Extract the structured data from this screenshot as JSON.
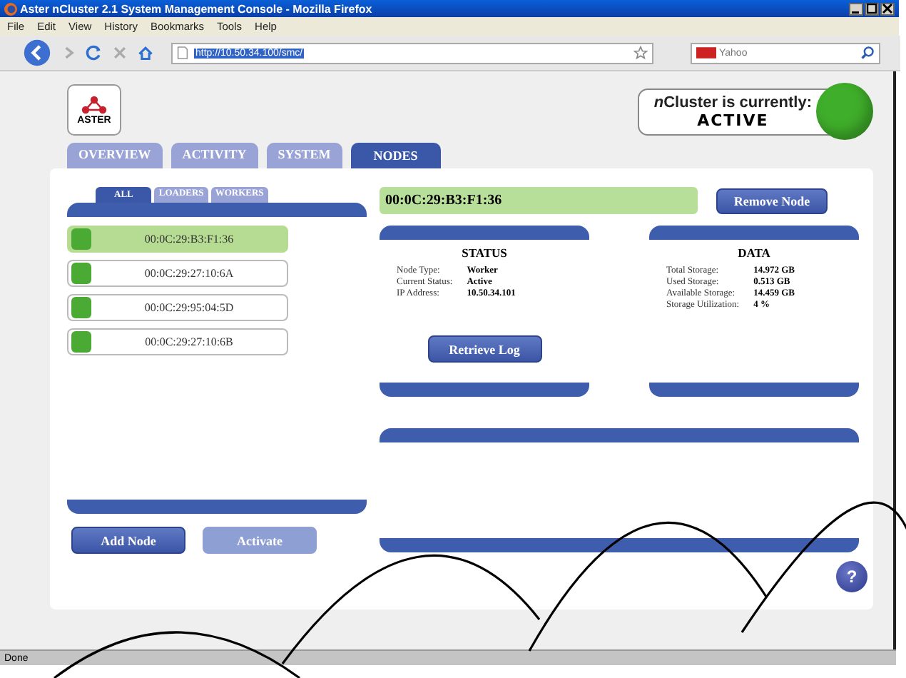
{
  "window": {
    "title": "Aster nCluster 2.1 System Management Console - Mozilla Firefox"
  },
  "menu": [
    "File",
    "Edit",
    "View",
    "History",
    "Bookmarks",
    "Tools",
    "Help"
  ],
  "address": {
    "value": "http://10.50.34.100/smc/"
  },
  "search": {
    "placeholder": "Yahoo"
  },
  "logo": {
    "text": "ASTER"
  },
  "cluster_status": {
    "label_em": "n",
    "label": "Cluster is currently:",
    "value": "ACTIVE",
    "color": "#3fae2a"
  },
  "tabs": [
    {
      "label": "OVERVIEW",
      "selected": false
    },
    {
      "label": "ACTIVITY",
      "selected": false
    },
    {
      "label": "SYSTEM",
      "selected": false
    },
    {
      "label": "NODES",
      "selected": true
    }
  ],
  "subtabs": [
    {
      "label": "ALL",
      "selected": true
    },
    {
      "label": "LOADERS",
      "selected": false
    },
    {
      "label": "WORKERS",
      "selected": false
    }
  ],
  "nodes": [
    {
      "name": "00:0C:29:B3:F1:36",
      "selected": true
    },
    {
      "name": "00:0C:29:27:10:6A",
      "selected": false
    },
    {
      "name": "00:0C:29:95:04:5D",
      "selected": false
    },
    {
      "name": "00:0C:29:27:10:6B",
      "selected": false
    }
  ],
  "add_button": {
    "label": "Add Node",
    "disabled": false
  },
  "activate_button": {
    "label": "Activate",
    "disabled": true
  },
  "detail": {
    "node": "00:0C:29:B3:F1:36",
    "remove_button": "Remove Node",
    "status": {
      "title": "STATUS",
      "rows": [
        {
          "label": "Node Type:",
          "value": "Worker"
        },
        {
          "label": "Current Status:",
          "value": "Active"
        },
        {
          "label": "IP Address:",
          "value": "10.50.34.101"
        }
      ],
      "button": "Retrieve Log"
    },
    "data": {
      "title": "DATA",
      "rows": [
        {
          "label": "Total Storage:",
          "value": "14.972 GB"
        },
        {
          "label": "Used Storage:",
          "value": "0.513 GB"
        },
        {
          "label": "Available Storage:",
          "value": "14.459 GB"
        },
        {
          "label": "Storage Utilization:",
          "value": "4 %"
        }
      ]
    }
  },
  "help": "?",
  "status_bar": "Done"
}
